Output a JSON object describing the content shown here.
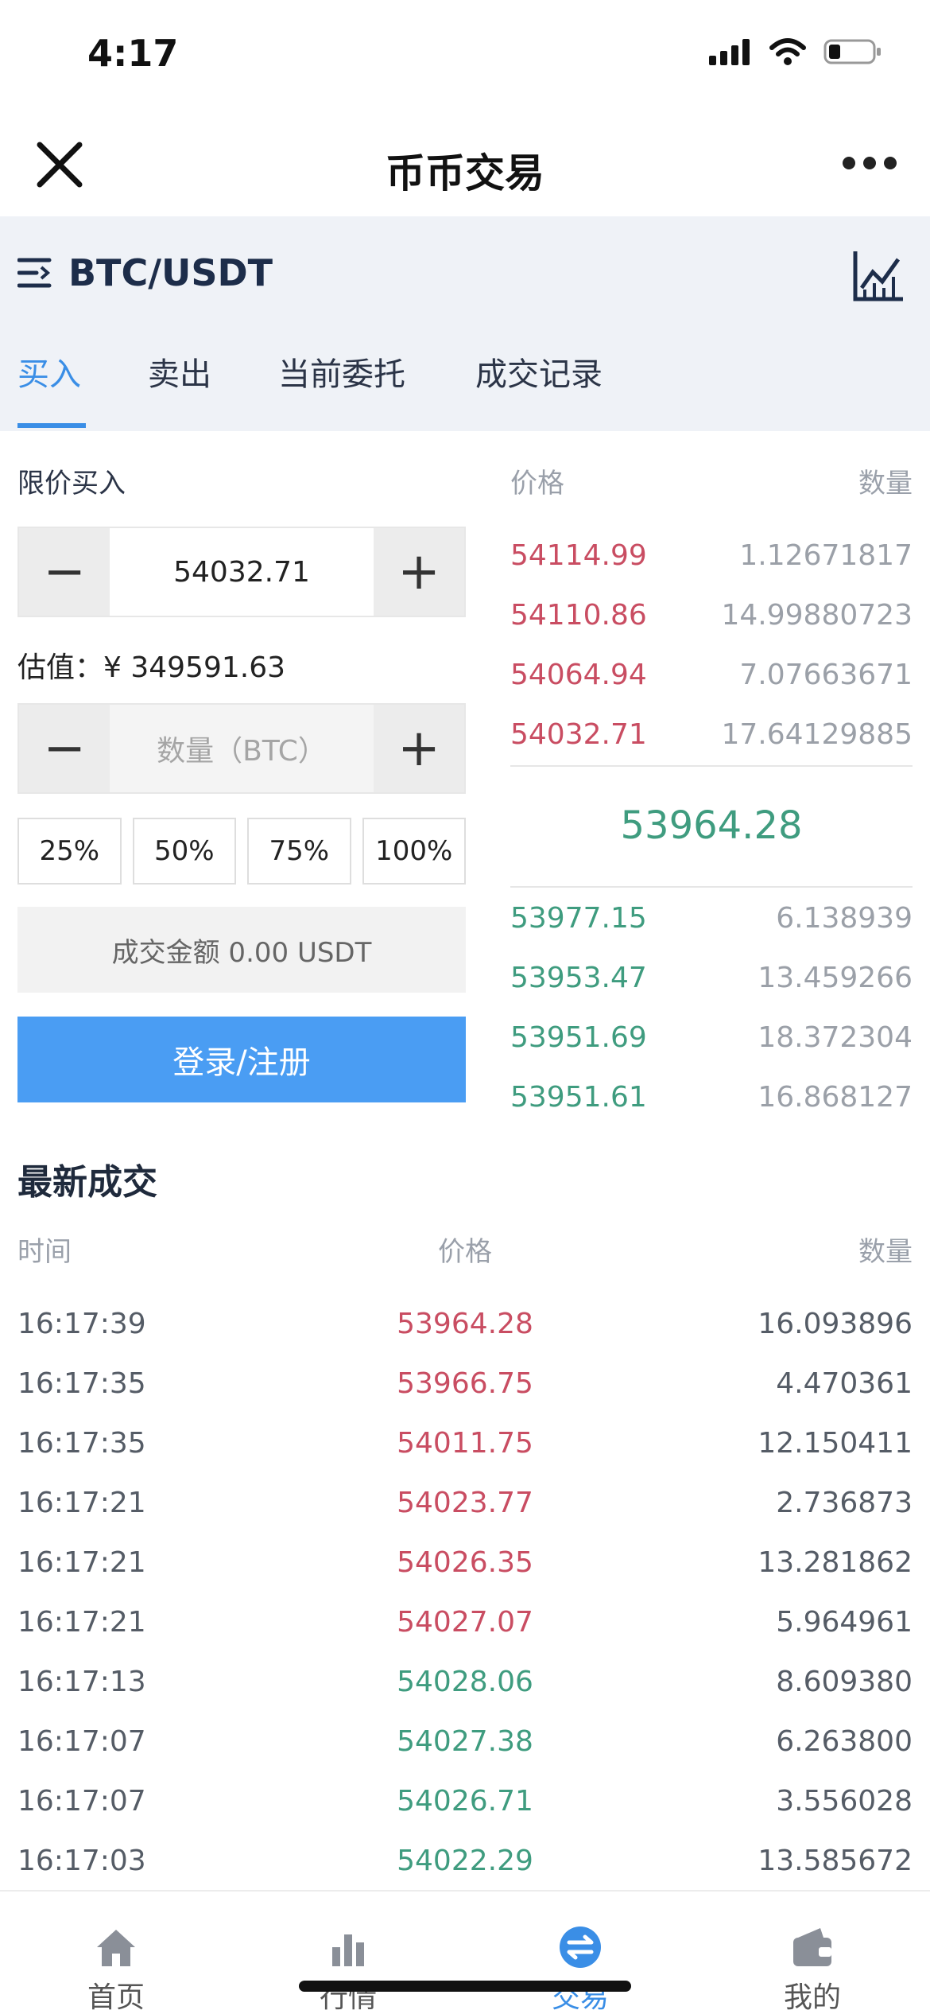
{
  "status_bar": {
    "time": "4:17"
  },
  "nav": {
    "title": "币币交易"
  },
  "pair": {
    "name": "BTC/USDT"
  },
  "tabs": [
    {
      "label": "买入",
      "active": true
    },
    {
      "label": "卖出",
      "active": false
    },
    {
      "label": "当前委托",
      "active": false
    },
    {
      "label": "成交记录",
      "active": false
    }
  ],
  "order_form": {
    "order_type_label": "限价买入",
    "price_value": "54032.71",
    "estimate": "估值：¥ 349591.63",
    "quantity_placeholder": "数量（BTC）",
    "percent_buttons": [
      "25%",
      "50%",
      "75%",
      "100%"
    ],
    "amount_text": "成交金额 0.00 USDT",
    "login_button": "登录/注册"
  },
  "order_book": {
    "header_price": "价格",
    "header_qty": "数量",
    "asks": [
      {
        "price": "54114.99",
        "qty": "1.12671817"
      },
      {
        "price": "54110.86",
        "qty": "14.99880723"
      },
      {
        "price": "54064.94",
        "qty": "7.07663671"
      },
      {
        "price": "54032.71",
        "qty": "17.64129885"
      }
    ],
    "last_price": "53964.28",
    "bids": [
      {
        "price": "53977.15",
        "qty": "6.138939"
      },
      {
        "price": "53953.47",
        "qty": "13.459266"
      },
      {
        "price": "53951.69",
        "qty": "18.372304"
      },
      {
        "price": "53951.61",
        "qty": "16.868127"
      }
    ]
  },
  "latest_trades": {
    "title": "最新成交",
    "header_time": "时间",
    "header_price": "价格",
    "header_qty": "数量",
    "rows": [
      {
        "time": "16:17:39",
        "price": "53964.28",
        "qty": "16.093896",
        "side": "sell"
      },
      {
        "time": "16:17:35",
        "price": "53966.75",
        "qty": "4.470361",
        "side": "sell"
      },
      {
        "time": "16:17:35",
        "price": "54011.75",
        "qty": "12.150411",
        "side": "sell"
      },
      {
        "time": "16:17:21",
        "price": "54023.77",
        "qty": "2.736873",
        "side": "sell"
      },
      {
        "time": "16:17:21",
        "price": "54026.35",
        "qty": "13.281862",
        "side": "sell"
      },
      {
        "time": "16:17:21",
        "price": "54027.07",
        "qty": "5.964961",
        "side": "sell"
      },
      {
        "time": "16:17:13",
        "price": "54028.06",
        "qty": "8.609380",
        "side": "buy"
      },
      {
        "time": "16:17:07",
        "price": "54027.38",
        "qty": "6.263800",
        "side": "buy"
      },
      {
        "time": "16:17:07",
        "price": "54026.71",
        "qty": "3.556028",
        "side": "buy"
      },
      {
        "time": "16:17:03",
        "price": "54022.29",
        "qty": "13.585672",
        "side": "buy"
      }
    ]
  },
  "tab_bar": [
    {
      "label": "首页",
      "icon": "home-icon",
      "active": false
    },
    {
      "label": "行情",
      "icon": "bar-chart-icon",
      "active": false
    },
    {
      "label": "交易",
      "icon": "exchange-icon",
      "active": true
    },
    {
      "label": "我的",
      "icon": "wallet-icon",
      "active": false
    }
  ],
  "colors": {
    "accent": "#3a8ee6",
    "sell": "#c94d62",
    "buy": "#3f9c7f",
    "button": "#4a9df3"
  }
}
